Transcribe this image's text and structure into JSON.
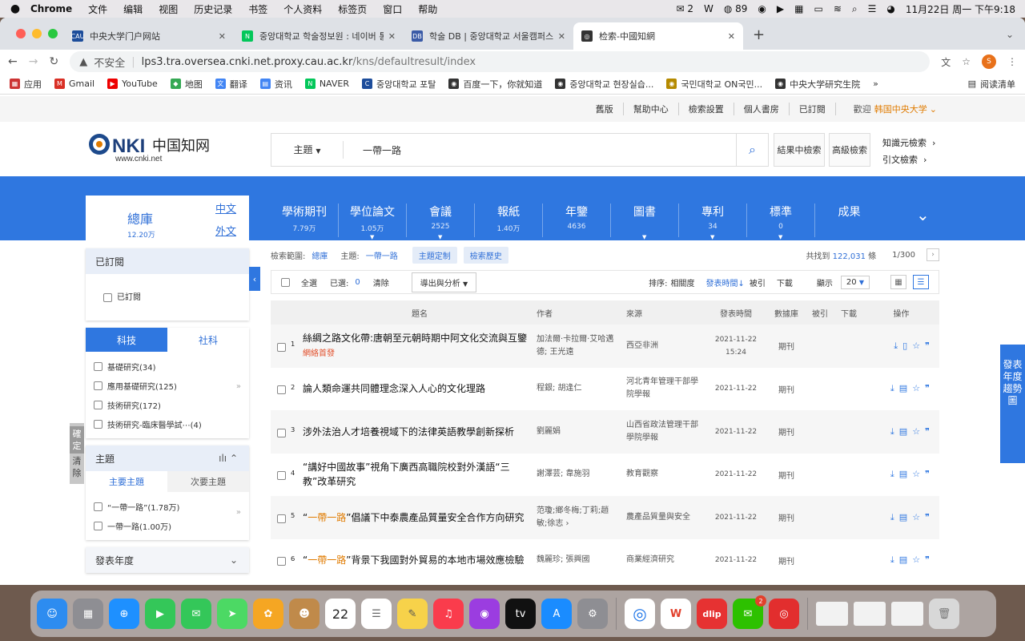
{
  "menubar": {
    "apple": "",
    "items": [
      "Chrome",
      "文件",
      "编辑",
      "视图",
      "历史记录",
      "书签",
      "个人资料",
      "标签页",
      "窗口",
      "帮助"
    ],
    "wechat_count": "2",
    "notif_count": "89",
    "datetime": "11月22日 周一 下午9:18"
  },
  "tabs": [
    {
      "title": "中央大学门户网站",
      "fav": "CAU",
      "color": "#1d4d9b"
    },
    {
      "title": "중앙대학교 학술정보원 : 네이버 통합...",
      "fav": "N",
      "color": "#03c75a"
    },
    {
      "title": "학술 DB | 중앙대학교 서울캠퍼스 학...",
      "fav": "DB",
      "color": "#3b5ba7"
    },
    {
      "title": "检索-中國知網",
      "fav": "◎",
      "color": "#333333"
    }
  ],
  "address": {
    "insecure": "不安全",
    "host": "lps3.tra.oversea.cnki.net.proxy.cau.ac.kr",
    "path": "/kns/defaultresult/index",
    "profile": "S"
  },
  "bookmarks": [
    {
      "label": "应用",
      "icon": "▦",
      "color": "#c33"
    },
    {
      "label": "Gmail",
      "icon": "M",
      "color": "#d93025"
    },
    {
      "label": "YouTube",
      "icon": "▶",
      "color": "#e00"
    },
    {
      "label": "地图",
      "icon": "◆",
      "color": "#34a853"
    },
    {
      "label": "翻译",
      "icon": "文",
      "color": "#4285f4"
    },
    {
      "label": "资讯",
      "icon": "▤",
      "color": "#4285f4"
    },
    {
      "label": "NAVER",
      "icon": "N",
      "color": "#03c75a"
    },
    {
      "label": "중앙대학교 포탈",
      "icon": "C",
      "color": "#1d4d9b"
    },
    {
      "label": "百度一下，你就知道",
      "icon": "◉",
      "color": "#333"
    },
    {
      "label": "중앙대학교 현장실습...",
      "icon": "◉",
      "color": "#333"
    },
    {
      "label": "국민대학교 ON국민...",
      "icon": "◉",
      "color": "#b58a00"
    },
    {
      "label": "中央大学研究生院",
      "icon": "◉",
      "color": "#333"
    }
  ],
  "reading_list": "阅读清单",
  "topnav": {
    "links": [
      "舊版",
      "幫助中心",
      "檢索設置",
      "個人書房",
      "已訂閱"
    ],
    "welcome": "歡迎",
    "org": "韩国中央大学"
  },
  "search": {
    "field": "主題",
    "query": "一帶一路",
    "btn_in_results": "結果中檢索",
    "btn_advanced": "高級檢索",
    "link_knowledge": "知識元檢索",
    "link_citation": "引文檢索"
  },
  "zongku": {
    "title": "總庫",
    "count": "12.20万",
    "lang_cn": "中文",
    "lang_foreign": "外文"
  },
  "categories": [
    {
      "name": "學術期刊",
      "count": "7.79万"
    },
    {
      "name": "學位論文",
      "count": "1.05万"
    },
    {
      "name": "會議",
      "count": "2525"
    },
    {
      "name": "報紙",
      "count": "1.40万"
    },
    {
      "name": "年鑒",
      "count": "4636"
    },
    {
      "name": "圖書",
      "count": ""
    },
    {
      "name": "專利",
      "count": "34"
    },
    {
      "name": "標準",
      "count": "0"
    },
    {
      "name": "成果",
      "count": ""
    }
  ],
  "sidebar": {
    "subscribed_head": "已訂閱",
    "subscribed_item": "已訂閱",
    "confirm": "確定",
    "clear": "清除",
    "tab_sci": "科技",
    "tab_soc": "社科",
    "sci_items": [
      "基礎研究(34)",
      "應用基礎研究(125)",
      "技術研究(172)",
      "技術研究-臨床醫學試⋯(4)"
    ],
    "topic_head": "主題",
    "topic_main": "主要主題",
    "topic_sub": "次要主題",
    "topic_items": [
      "“一帶一路”(1.78万)",
      "一帶一路(1.00万)"
    ],
    "year_head": "發表年度"
  },
  "scope": {
    "label": "檢索範圍:",
    "db": "總庫",
    "topic_label": "主題:",
    "topic": "一帶一路",
    "btn_custom": "主題定制",
    "btn_history": "檢索歷史",
    "found_label": "共找到",
    "found": "122,031",
    "found_unit": "條",
    "page": "1/300"
  },
  "toolbar": {
    "select_all": "全選",
    "selected_label": "已選:",
    "selected": "0",
    "clear": "清除",
    "export": "導出與分析",
    "sort_label": "排序:",
    "sort_rel": "相關度",
    "sort_date": "發表時間",
    "sort_cite": "被引",
    "sort_dl": "下載",
    "show_label": "顯示",
    "page_size": "20"
  },
  "table": {
    "headers": [
      "題名",
      "作者",
      "來源",
      "發表時間",
      "數據庫",
      "被引",
      "下載",
      "操作"
    ],
    "rows": [
      {
        "no": "1",
        "title": "絲綢之路文化帶:唐朝至元朝時期中阿文化交流與互鑒",
        "tag": "網絡首發",
        "authors": "加法爾·卡拉爾·艾哈邁德; 王光遠",
        "source": "西亞非洲",
        "date": "2021-11-22 15:24",
        "db": "期刊"
      },
      {
        "no": "2",
        "title": "論人類命運共同體理念深入人心的文化理路",
        "tag": "",
        "authors": "程銀; 胡逢仁",
        "source": "河北青年管理干部學院學報",
        "date": "2021-11-22",
        "db": "期刊"
      },
      {
        "no": "3",
        "title": "涉外法治人才培養視域下的法律英語教學創新探析",
        "tag": "",
        "authors": "劉麗娟",
        "source": "山西省政法管理干部學院學報",
        "date": "2021-11-22",
        "db": "期刊"
      },
      {
        "no": "4",
        "title": "“講好中國故事”視角下廣西高職院校對外漢語“三教”改革研究",
        "tag": "",
        "authors": "謝澤芸; 韋施羽",
        "source": "教育觀察",
        "date": "2021-11-22",
        "db": "期刊"
      },
      {
        "no": "5",
        "title_hl": "一帶一路",
        "title_pre": "“",
        "title_rest": "”倡議下中泰農產品質量安全合作方向研究",
        "tag": "",
        "authors": "范瓊;鄉冬梅;丁莉;趙敏;徐志 ›",
        "source": "農產品質量與安全",
        "date": "2021-11-22",
        "db": "期刊"
      },
      {
        "no": "6",
        "title_hl": "一帶一路",
        "title_pre": "“",
        "title_rest": "”背景下我國對外貿易的本地市場效應檢驗",
        "tag": "",
        "authors": "魏麗珍; 張興國",
        "source": "商業經濟研究",
        "date": "2021-11-22",
        "db": "期刊"
      }
    ]
  },
  "trend": "發表年度趨勢圖",
  "dock": [
    {
      "name": "finder",
      "label": "☺",
      "color": "#2d8cf0"
    },
    {
      "name": "launchpad",
      "label": "▦",
      "color": "#8e8e93"
    },
    {
      "name": "safari",
      "label": "⊕",
      "color": "#1e90ff"
    },
    {
      "name": "facetime",
      "label": "▶",
      "color": "#34c759"
    },
    {
      "name": "messages",
      "label": "✉",
      "color": "#34c759"
    },
    {
      "name": "maps",
      "label": "➤",
      "color": "#4cd964"
    },
    {
      "name": "photos",
      "label": "✿",
      "color": "#f5a623"
    },
    {
      "name": "contacts",
      "label": "☻",
      "color": "#c08a4a"
    },
    {
      "name": "calendar",
      "label": "22",
      "color": "#ffffff"
    },
    {
      "name": "reminders",
      "label": "☰",
      "color": "#ffffff"
    },
    {
      "name": "notes",
      "label": "✎",
      "color": "#f7d24a"
    },
    {
      "name": "music",
      "label": "♫",
      "color": "#fa3c4c"
    },
    {
      "name": "podcasts",
      "label": "◉",
      "color": "#9b3de0"
    },
    {
      "name": "tv",
      "label": "tv",
      "color": "#111111"
    },
    {
      "name": "appstore",
      "label": "A",
      "color": "#1a8cff"
    },
    {
      "name": "settings",
      "label": "⚙",
      "color": "#8e8e93"
    },
    {
      "name": "chrome",
      "label": "◎",
      "color": "#ffffff"
    },
    {
      "name": "wps",
      "label": "W",
      "color": "#ffffff"
    },
    {
      "name": "dlip",
      "label": "dlip",
      "color": "#e63232"
    },
    {
      "name": "wechat",
      "label": "✉",
      "color": "#2dc100",
      "badge": "2"
    },
    {
      "name": "netease",
      "label": "◎",
      "color": "#e22e2e"
    },
    {
      "name": "win1",
      "label": "",
      "color": "#f2f2f2"
    },
    {
      "name": "win2",
      "label": "",
      "color": "#f2f2f2"
    },
    {
      "name": "win3",
      "label": "",
      "color": "#f2f2f2"
    },
    {
      "name": "trash",
      "label": "🗑",
      "color": "#d8d8d8"
    }
  ]
}
